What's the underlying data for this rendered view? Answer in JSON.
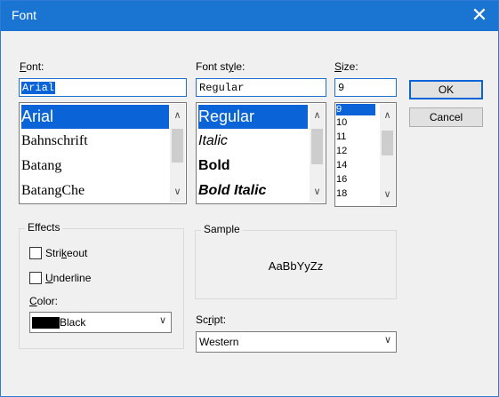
{
  "window": {
    "title": "Font",
    "close_glyph": "✕"
  },
  "font": {
    "label_pre": "",
    "label_u": "F",
    "label_post": "ont:",
    "value": "Arial",
    "items": [
      "Arial",
      "Bahnschrift",
      "Batang",
      "BatangChe"
    ]
  },
  "style": {
    "label_pre": "Font st",
    "label_u": "y",
    "label_post": "le:",
    "value": "Regular",
    "items": [
      "Regular",
      "Italic",
      "Bold",
      "Bold Italic"
    ]
  },
  "size": {
    "label_pre": "",
    "label_u": "S",
    "label_post": "ize:",
    "value": "9",
    "items": [
      "9",
      "10",
      "11",
      "12",
      "14",
      "16",
      "18"
    ]
  },
  "buttons": {
    "ok": "OK",
    "cancel": "Cancel"
  },
  "effects": {
    "label": "Effects",
    "strikeout_pre": "Stri",
    "strikeout_u": "k",
    "strikeout_post": "eout",
    "underline_pre": "",
    "underline_u": "U",
    "underline_post": "nderline",
    "color_label_pre": "",
    "color_label_u": "C",
    "color_label_post": "olor:",
    "color_value": "Black",
    "color_swatch": "#000000"
  },
  "sample": {
    "label": "Sample",
    "text": "AaBbYyZz"
  },
  "script": {
    "label_pre": "Sc",
    "label_u": "r",
    "label_post": "ipt:",
    "value": "Western"
  },
  "icons": {
    "up": "chevron-up-icon",
    "down": "chevron-down-icon"
  },
  "colors": {
    "title_bar": "#1a75d2",
    "selection": "#0a64d8"
  }
}
